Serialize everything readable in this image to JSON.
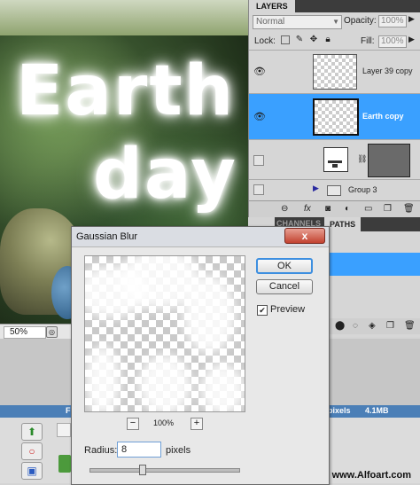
{
  "canvas": {
    "text_line1": "Earth",
    "text_line2": "day",
    "zoom": "50%"
  },
  "layers_panel": {
    "tab": "LAYERS",
    "blend_mode": "Normal",
    "opacity_label": "Opacity:",
    "opacity_value": "100%",
    "lock_label": "Lock:",
    "fill_label": "Fill:",
    "fill_value": "100%",
    "layers": [
      {
        "name": "Layer 39 copy",
        "visible": true,
        "selected": false
      },
      {
        "name": "Earth copy",
        "visible": true,
        "selected": true
      },
      {
        "name": "",
        "visible": false,
        "selected": false
      },
      {
        "name": "Group 3",
        "visible": false,
        "selected": false
      }
    ]
  },
  "second_panel": {
    "tab_channels": "CHANNELS",
    "tab_paths": "PATHS"
  },
  "info_bar": {
    "left_fragment": "F",
    "pixels": "pixels",
    "size": "4.1MB"
  },
  "watermark": "www.Alfoart.com",
  "dialog": {
    "title": "Gaussian Blur",
    "close_glyph": "x",
    "ok_label": "OK",
    "cancel_label": "Cancel",
    "preview_label": "Preview",
    "preview_checked": true,
    "zoom_minus": "−",
    "zoom_pct": "100%",
    "zoom_plus": "+",
    "radius_label": "Radius:",
    "radius_value": "8",
    "radius_unit": "pixels"
  },
  "colors": {
    "selection": "#3aa0ff",
    "info_bar": "#4b7fb7",
    "close_button": "#c2412f"
  }
}
